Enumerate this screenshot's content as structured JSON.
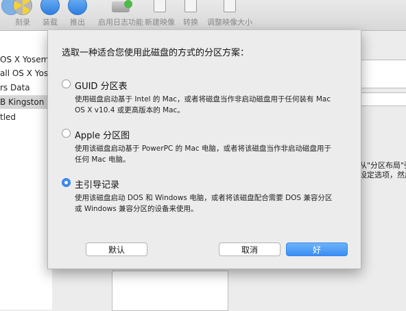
{
  "toolbar": {
    "items": [
      {
        "label": "",
        "icon": "disk-utility-icon"
      },
      {
        "label": "刻录",
        "icon": "burn-icon"
      },
      {
        "label": "装载",
        "icon": "mount-icon"
      },
      {
        "label": "推出",
        "icon": "eject-icon"
      },
      {
        "label": "启用日志功能",
        "icon": "journal-icon"
      },
      {
        "label": "新建映像",
        "icon": "new-image-icon"
      },
      {
        "label": "转换",
        "icon": "convert-icon"
      },
      {
        "label": "调整映像大小",
        "icon": "resize-image-icon"
      }
    ]
  },
  "sidebar": {
    "items": [
      {
        "label": "OS X Yosem",
        "selected": false
      },
      {
        "label": "all OS X Yose",
        "selected": false
      },
      {
        "label": "rs Data",
        "selected": false
      },
      {
        "label": "B Kingston D",
        "selected": true
      },
      {
        "label": "tled",
        "selected": false
      }
    ]
  },
  "background_text": {
    "line1": "从\"分区布局\"弹",
    "line2": "设定选项，然后"
  },
  "sheet": {
    "title": "选取一种适合您使用此磁盘的方式的分区方案：",
    "options": [
      {
        "label": "GUID 分区表",
        "selected": false,
        "desc1": "使用磁盘启动基于 Intel 的 Mac，或者将磁盘当作非启动磁盘用于任何装有 Mac",
        "desc2": "OS X v10.4 或更高版本的 Mac。"
      },
      {
        "label": "Apple 分区图",
        "selected": false,
        "desc1": "使用该磁盘启动基于 PowerPC 的 Mac 电脑，或者将该磁盘当作非启动磁盘用于",
        "desc2": "任何 Mac 电脑。"
      },
      {
        "label": "主引导记录",
        "selected": true,
        "desc1": "使用该磁盘启动 DOS 和 Windows 电脑，或者将该磁盘配合需要 DOS 兼容分区",
        "desc2": "或 Windows 兼容分区的设备来使用。"
      }
    ],
    "buttons": {
      "default": "默认",
      "cancel": "取消",
      "ok": "好"
    }
  },
  "colors": {
    "accent": "#3b8ef5"
  }
}
